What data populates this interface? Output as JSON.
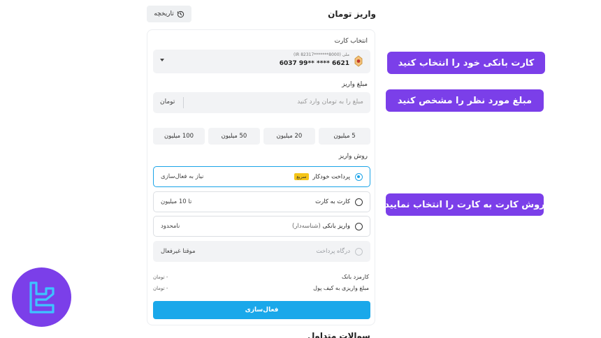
{
  "header": {
    "title": "واریز تومان",
    "history_label": "تاریخچه",
    "history_icon": "history-icon"
  },
  "card_section": {
    "label": "انتخاب کارت",
    "iban": "ملی (IR 82317*******8000)",
    "card_number": "6037 99** **** 6621",
    "bank_icon": "bank-logo-icon"
  },
  "amount_section": {
    "label": "مبلغ واریز",
    "placeholder": "مبلغ را به تومان وارد کنید",
    "unit": "تومان"
  },
  "quick_amounts": [
    "5 میلیون",
    "20 میلیون",
    "50 میلیون",
    "100 میلیون"
  ],
  "method_section": {
    "label": "روش واریز",
    "methods": [
      {
        "title": "پرداخت خودکار",
        "badge": "سریع",
        "note": "نیاز به فعال‌سازی",
        "state": "selected"
      },
      {
        "title": "کارت به کارت",
        "note": "تا 10 میلیون",
        "state": "normal"
      },
      {
        "title": "واریز بانکی",
        "subtitle": "(شناسه‌دار)",
        "note": "نامحدود",
        "state": "normal"
      },
      {
        "title": "درگاه پرداخت",
        "note": "موقتا غیرفعال",
        "state": "disabled"
      }
    ]
  },
  "fees": [
    {
      "label": "کارمزد بانک",
      "value": "- تومان"
    },
    {
      "label": "مبلغ واریزی به کیف پول",
      "value": "- تومان"
    }
  ],
  "submit_label": "فعال‌سازی",
  "footer_partial": "سوالات متداول",
  "annotations": {
    "card": "کارت بانکی خود را انتخاب کنید",
    "amount": "مبلغ مورد نظر را مشخص کنید",
    "method": "روش کارت به کارت را انتخاب نمایید"
  },
  "colors": {
    "accent": "#1aa8ea",
    "annotation": "#7b3fe9",
    "badge": "#f5c518"
  }
}
